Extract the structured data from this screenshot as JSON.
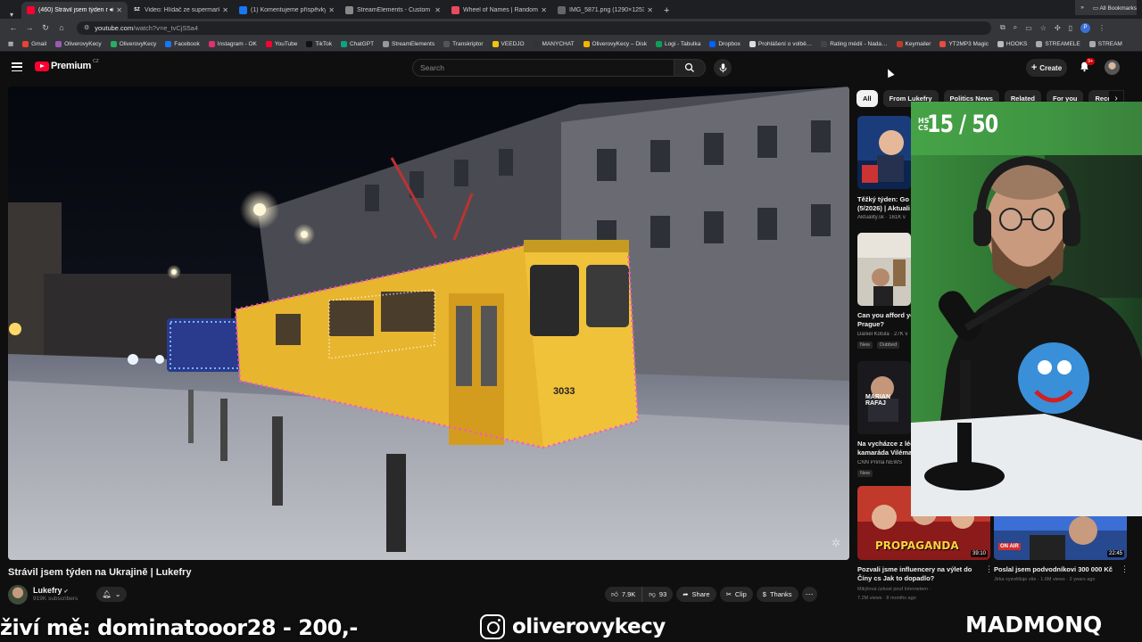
{
  "browser": {
    "tabs": [
      {
        "title": "(460) Strávil jsem týden na",
        "favicon_color": "#ff0033",
        "active": true,
        "audio": true
      },
      {
        "title": "Video: Hlídač ze supermarketu",
        "favicon_color": "#222222",
        "favicon_text": "SZ",
        "active": false
      },
      {
        "title": "(1) Komentujeme příspěvky de",
        "favicon_color": "#1877f2",
        "active": false
      },
      {
        "title": "StreamElements - Custom comm",
        "favicon_color": "#888888",
        "active": false
      },
      {
        "title": "Wheel of Names | Random nam",
        "favicon_color": "#e84a5f",
        "active": false
      },
      {
        "title": "IMG_5871.png (1290×1253)",
        "favicon_color": "#666666",
        "active": false
      }
    ],
    "url_host": "youtube.com",
    "url_rest": "/watch?v=e_tvCjS5a4",
    "bookmarks": [
      {
        "label": "Gmail",
        "color": "#ea4335"
      },
      {
        "label": "OliverovyKecy",
        "color": "#9b59b6"
      },
      {
        "label": "OliverovyKecy",
        "color": "#27ae60"
      },
      {
        "label": "Facebook",
        "color": "#1877f2"
      },
      {
        "label": "Instagram - OK",
        "color": "#e1306c"
      },
      {
        "label": "YouTube",
        "color": "#ff0033"
      },
      {
        "label": "TikTok",
        "color": "#111111"
      },
      {
        "label": "ChatGPT",
        "color": "#10a37f"
      },
      {
        "label": "StreamElements",
        "color": "#999999"
      },
      {
        "label": "Transkriptor",
        "color": "#555555"
      },
      {
        "label": "VEEDJO",
        "color": "#f1c40f"
      },
      {
        "label": "MANYCHAT",
        "color": "#333333"
      },
      {
        "label": "OliverovyKecy – Disk",
        "color": "#f4b400"
      },
      {
        "label": "Logi - Tabulka",
        "color": "#0f9d58"
      },
      {
        "label": "Dropbox",
        "color": "#0061ff"
      },
      {
        "label": "Prohlášení o volbě…",
        "color": "#dddddd"
      },
      {
        "label": "Rating médií - Nada…",
        "color": "#444444"
      },
      {
        "label": "Keymailer",
        "color": "#c0392b"
      },
      {
        "label": "YT2MP3 Magic",
        "color": "#e74c3c"
      },
      {
        "label": "HOOKS",
        "color": "#bbbbbb"
      },
      {
        "label": "STREAMELE",
        "color": "#aaaaaa"
      },
      {
        "label": "STREAM",
        "color": "#aaaaaa"
      }
    ],
    "all_bookmarks": "All Bookmarks"
  },
  "youtube": {
    "logo_word": "Premium",
    "logo_region": "CZ",
    "search_placeholder": "Search",
    "create_label": "Create",
    "notifications": "9+"
  },
  "video": {
    "title": "Strávil jsem týden na Ukrajině | Lukefry",
    "channel": "Lukefry",
    "subscribers": "919K subscribers",
    "likes": "7.9K",
    "dislikes": "93",
    "share": "Share",
    "clip": "Clip",
    "thanks": "Thanks",
    "tram_number": "3033"
  },
  "sidebar": {
    "chips": [
      "All",
      "From Lukefry",
      "Politics News",
      "Related",
      "For you",
      "Recently uploaded"
    ],
    "recommendations": [
      {
        "title": "Těžký týden: Go",
        "title2": "(5/2026) | Aktuali",
        "meta": "Aktuality.sk · 161K v",
        "badge": ""
      },
      {
        "title": "Can you afford yo",
        "title2": "Prague?",
        "meta": "Daniel Kotula · 27K v",
        "badge": "New",
        "badge2": "Dubbed"
      },
      {
        "title": "Na vycházce z léč",
        "title2": "kamaráda Viléma",
        "meta": "CNN Prima NEWS",
        "badge": "New",
        "thumb_text": "MARIAN RAFAJ"
      }
    ],
    "grid": [
      {
        "title": "Pozvali jsme influencery na výlet do",
        "title2": "Číny cs Jak to dopadlo?",
        "meta": "Mikýlová úzkost pouf Internetem ·",
        "meta2": "7.2M views · 8 months ago",
        "duration": "39:10",
        "thumb_text": "PROPAGANDA"
      },
      {
        "title": "Poslal jsem podvodníkovi 300 000 Kč",
        "title2": "",
        "meta": "Jirka vysvětluje vše · 1.6M views · 2 years ago",
        "meta2": "",
        "duration": "22:45",
        "thumb_text": "ON AIR",
        "thumb_text2": "300 000 Kč"
      }
    ]
  },
  "webcam": {
    "counter_small": "HS CS",
    "counter": "15 / 50"
  },
  "overlay": {
    "donation": "živí mě: dominatooor28 - 200,-",
    "instagram": "oliverovykecy",
    "brand": "MADMONQ"
  }
}
